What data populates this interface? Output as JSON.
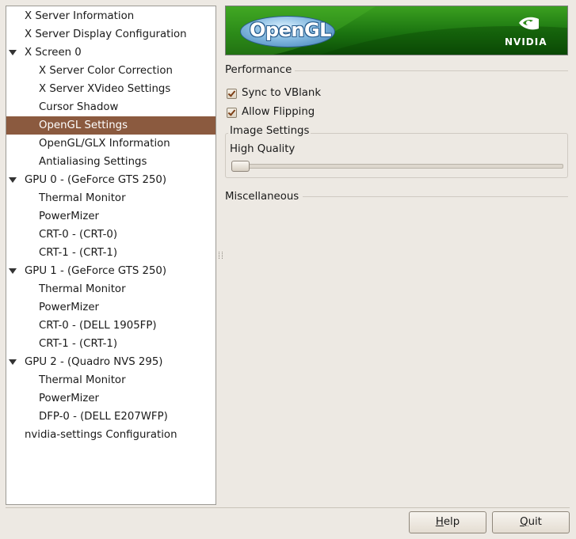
{
  "tree": {
    "items": [
      {
        "label": "X Server Information",
        "level": 0,
        "expander": false,
        "selected": false
      },
      {
        "label": "X Server Display Configuration",
        "level": 0,
        "expander": false,
        "selected": false
      },
      {
        "label": "X Screen 0",
        "level": 0,
        "expander": true,
        "selected": false
      },
      {
        "label": "X Server Color Correction",
        "level": 1,
        "expander": false,
        "selected": false
      },
      {
        "label": "X Server XVideo Settings",
        "level": 1,
        "expander": false,
        "selected": false
      },
      {
        "label": "Cursor Shadow",
        "level": 1,
        "expander": false,
        "selected": false
      },
      {
        "label": "OpenGL Settings",
        "level": 1,
        "expander": false,
        "selected": true
      },
      {
        "label": "OpenGL/GLX Information",
        "level": 1,
        "expander": false,
        "selected": false
      },
      {
        "label": "Antialiasing Settings",
        "level": 1,
        "expander": false,
        "selected": false
      },
      {
        "label": "GPU 0 - (GeForce GTS 250)",
        "level": 0,
        "expander": true,
        "selected": false
      },
      {
        "label": "Thermal Monitor",
        "level": 1,
        "expander": false,
        "selected": false
      },
      {
        "label": "PowerMizer",
        "level": 1,
        "expander": false,
        "selected": false
      },
      {
        "label": "CRT-0 - (CRT-0)",
        "level": 1,
        "expander": false,
        "selected": false
      },
      {
        "label": "CRT-1 - (CRT-1)",
        "level": 1,
        "expander": false,
        "selected": false
      },
      {
        "label": "GPU 1 - (GeForce GTS 250)",
        "level": 0,
        "expander": true,
        "selected": false
      },
      {
        "label": "Thermal Monitor",
        "level": 1,
        "expander": false,
        "selected": false
      },
      {
        "label": "PowerMizer",
        "level": 1,
        "expander": false,
        "selected": false
      },
      {
        "label": "CRT-0 - (DELL 1905FP)",
        "level": 1,
        "expander": false,
        "selected": false
      },
      {
        "label": "CRT-1 - (CRT-1)",
        "level": 1,
        "expander": false,
        "selected": false
      },
      {
        "label": "GPU 2 - (Quadro NVS 295)",
        "level": 0,
        "expander": true,
        "selected": false
      },
      {
        "label": "Thermal Monitor",
        "level": 1,
        "expander": false,
        "selected": false
      },
      {
        "label": "PowerMizer",
        "level": 1,
        "expander": false,
        "selected": false
      },
      {
        "label": "DFP-0 - (DELL E207WFP)",
        "level": 1,
        "expander": false,
        "selected": false
      },
      {
        "label": "nvidia-settings Configuration",
        "level": 0,
        "expander": false,
        "selected": false
      }
    ]
  },
  "banner": {
    "logo_text": "OpenGL",
    "brand_text": "NVIDIA",
    "colors": {
      "green": "#1b7410",
      "logo_blue": "#3c7cb5"
    }
  },
  "performance": {
    "title": "Performance",
    "sync_vblank": {
      "label": "Sync to VBlank",
      "checked": true
    },
    "allow_flipping": {
      "label": "Allow Flipping",
      "checked": true
    }
  },
  "image_settings": {
    "title": "Image Settings",
    "quality_label": "High Quality",
    "slider_level": 0
  },
  "misc": {
    "title": "Miscellaneous"
  },
  "buttons": {
    "help_label": "Help",
    "help_mnemonic": "H",
    "help_rest": "elp",
    "quit_label": "Quit",
    "quit_mnemonic": "Q",
    "quit_rest": "uit"
  },
  "theme": {
    "window_bg": "#ede9e3",
    "selection_bg": "#8b5a3f"
  }
}
